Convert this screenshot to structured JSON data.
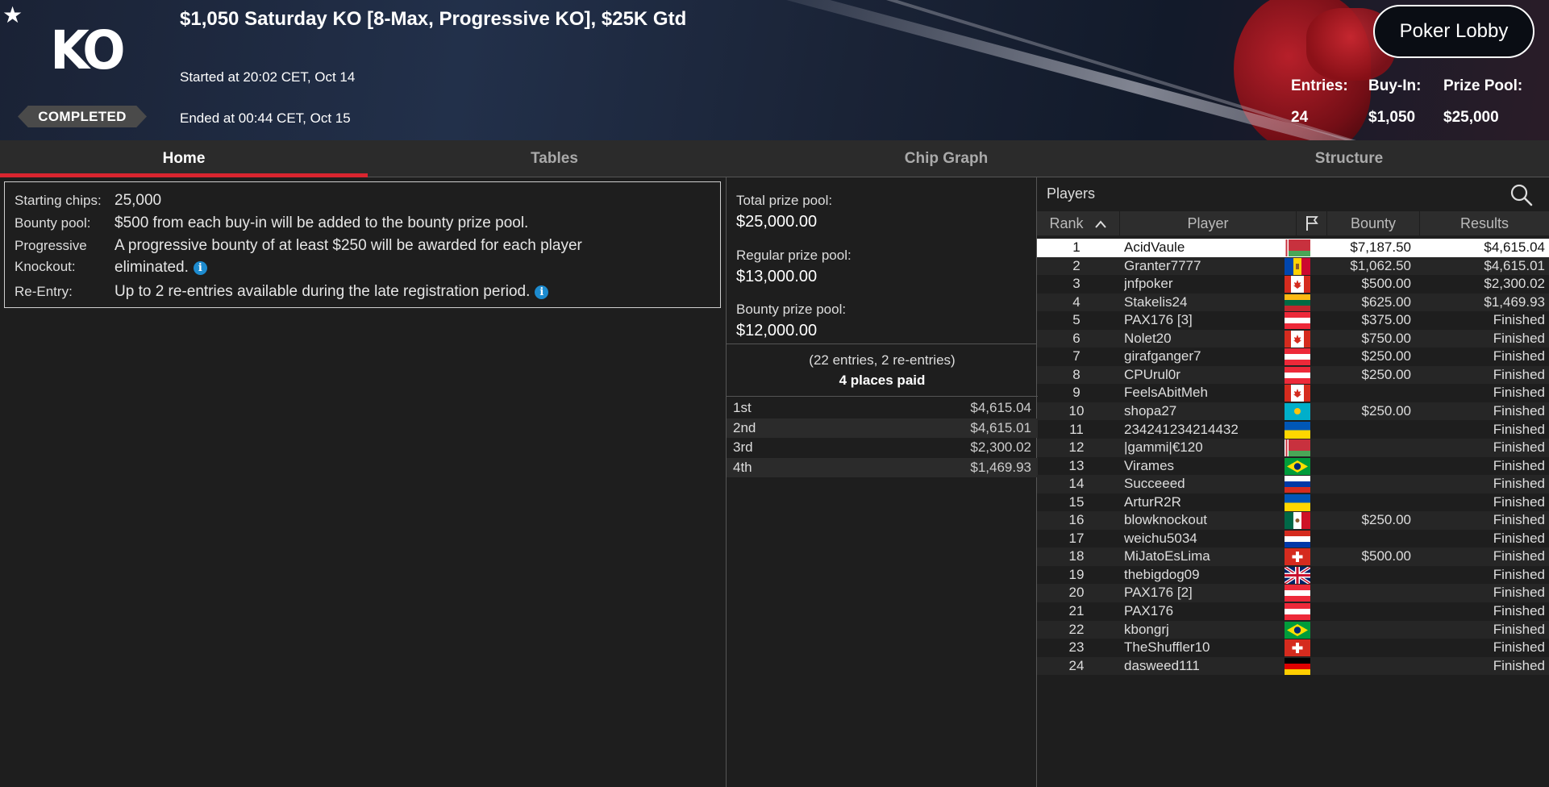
{
  "header": {
    "title": "$1,050 Saturday KO [8-Max, Progressive KO], $25K Gtd",
    "started": "Started at 20:02 CET, Oct 14",
    "ended": "Ended at 00:44 CET, Oct 15",
    "status": "COMPLETED",
    "logo_text": "KO",
    "star": "★",
    "lobby_button": "Poker Lobby",
    "stats": {
      "entries_label": "Entries:",
      "entries_value": "24",
      "buyin_label": "Buy-In:",
      "buyin_value": "$1,050",
      "prize_label": "Prize Pool:",
      "prize_value": "$25,000"
    }
  },
  "tabs": [
    "Home",
    "Tables",
    "Chip Graph",
    "Structure"
  ],
  "info": {
    "starting_chips_label": "Starting chips:",
    "starting_chips_value": "25,000",
    "bounty_pool_label": "Bounty pool:",
    "bounty_pool_value": "$500 from each buy-in will be added to the bounty prize pool.",
    "progressive_label_1": "Progressive",
    "progressive_label_2": "Knockout:",
    "progressive_value_1": "A progressive bounty of at least $250 will be awarded for each player",
    "progressive_value_2": "eliminated.",
    "reentry_label": "Re-Entry:",
    "reentry_value": "Up to 2 re-entries available during the late registration period.",
    "info_icon_glyph": "i"
  },
  "prize": {
    "total_label": "Total prize pool:",
    "total_value": "$25,000.00",
    "regular_label": "Regular prize pool:",
    "regular_value": "$13,000.00",
    "bounty_label": "Bounty prize pool:",
    "bounty_value": "$12,000.00",
    "entries_line": "(22 entries, 2 re-entries)",
    "places_line": "4 places paid",
    "payouts": [
      {
        "place": "1st",
        "amount": "$4,615.04"
      },
      {
        "place": "2nd",
        "amount": "$4,615.01"
      },
      {
        "place": "3rd",
        "amount": "$2,300.02"
      },
      {
        "place": "4th",
        "amount": "$1,469.93"
      }
    ]
  },
  "players": {
    "title": "Players",
    "columns": {
      "rank": "Rank",
      "player": "Player",
      "bounty": "Bounty",
      "results": "Results"
    },
    "sort_indicator": "^",
    "rows": [
      {
        "rank": "1",
        "name": "AcidVaule",
        "flag": "belarus",
        "bounty": "$7,187.50",
        "result": "$4,615.04"
      },
      {
        "rank": "2",
        "name": "Granter7777",
        "flag": "moldova",
        "bounty": "$1,062.50",
        "result": "$4,615.01"
      },
      {
        "rank": "3",
        "name": "jnfpoker",
        "flag": "canada",
        "bounty": "$500.00",
        "result": "$2,300.02"
      },
      {
        "rank": "4",
        "name": "Stakelis24",
        "flag": "lithuania",
        "bounty": "$625.00",
        "result": "$1,469.93"
      },
      {
        "rank": "5",
        "name": "PAX176 [3]",
        "flag": "austria",
        "bounty": "$375.00",
        "result": "Finished"
      },
      {
        "rank": "6",
        "name": "Nolet20",
        "flag": "canada",
        "bounty": "$750.00",
        "result": "Finished"
      },
      {
        "rank": "7",
        "name": "girafganger7",
        "flag": "austria",
        "bounty": "$250.00",
        "result": "Finished"
      },
      {
        "rank": "8",
        "name": "CPUrul0r",
        "flag": "austria",
        "bounty": "$250.00",
        "result": "Finished"
      },
      {
        "rank": "9",
        "name": "FeelsAbitMeh",
        "flag": "canada",
        "bounty": "",
        "result": "Finished"
      },
      {
        "rank": "10",
        "name": "shopa27",
        "flag": "kazakhstan",
        "bounty": "$250.00",
        "result": "Finished"
      },
      {
        "rank": "11",
        "name": "234241234214432",
        "flag": "ukraine",
        "bounty": "",
        "result": "Finished"
      },
      {
        "rank": "12",
        "name": "|gammi|€120",
        "flag": "belarus",
        "bounty": "",
        "result": "Finished"
      },
      {
        "rank": "13",
        "name": "Virames",
        "flag": "brazil",
        "bounty": "",
        "result": "Finished"
      },
      {
        "rank": "14",
        "name": "Succeeed",
        "flag": "russia",
        "bounty": "",
        "result": "Finished"
      },
      {
        "rank": "15",
        "name": "ArturR2R",
        "flag": "ukraine",
        "bounty": "",
        "result": "Finished"
      },
      {
        "rank": "16",
        "name": "blowknockout",
        "flag": "mexico",
        "bounty": "$250.00",
        "result": "Finished"
      },
      {
        "rank": "17",
        "name": "weichu5034",
        "flag": "paraguay",
        "bounty": "",
        "result": "Finished"
      },
      {
        "rank": "18",
        "name": "MiJatoEsLima",
        "flag": "switzerland",
        "bounty": "$500.00",
        "result": "Finished"
      },
      {
        "rank": "19",
        "name": "thebigdog09",
        "flag": "uk",
        "bounty": "",
        "result": "Finished"
      },
      {
        "rank": "20",
        "name": "PAX176 [2]",
        "flag": "austria",
        "bounty": "",
        "result": "Finished"
      },
      {
        "rank": "21",
        "name": "PAX176",
        "flag": "austria",
        "bounty": "",
        "result": "Finished"
      },
      {
        "rank": "22",
        "name": "kbongrj",
        "flag": "brazil",
        "bounty": "",
        "result": "Finished"
      },
      {
        "rank": "23",
        "name": "TheShuffler10",
        "flag": "switzerland",
        "bounty": "",
        "result": "Finished"
      },
      {
        "rank": "24",
        "name": "dasweed111",
        "flag": "germany",
        "bounty": "",
        "result": "Finished"
      }
    ]
  },
  "colors": {
    "accent_red": "#d9252f",
    "info_blue": "#1d8bcf",
    "selected_row": "#ffffff"
  },
  "icons": {
    "search": "search-icon",
    "flag_column": "flag-icon",
    "star": "star-icon",
    "info": "info-icon"
  }
}
